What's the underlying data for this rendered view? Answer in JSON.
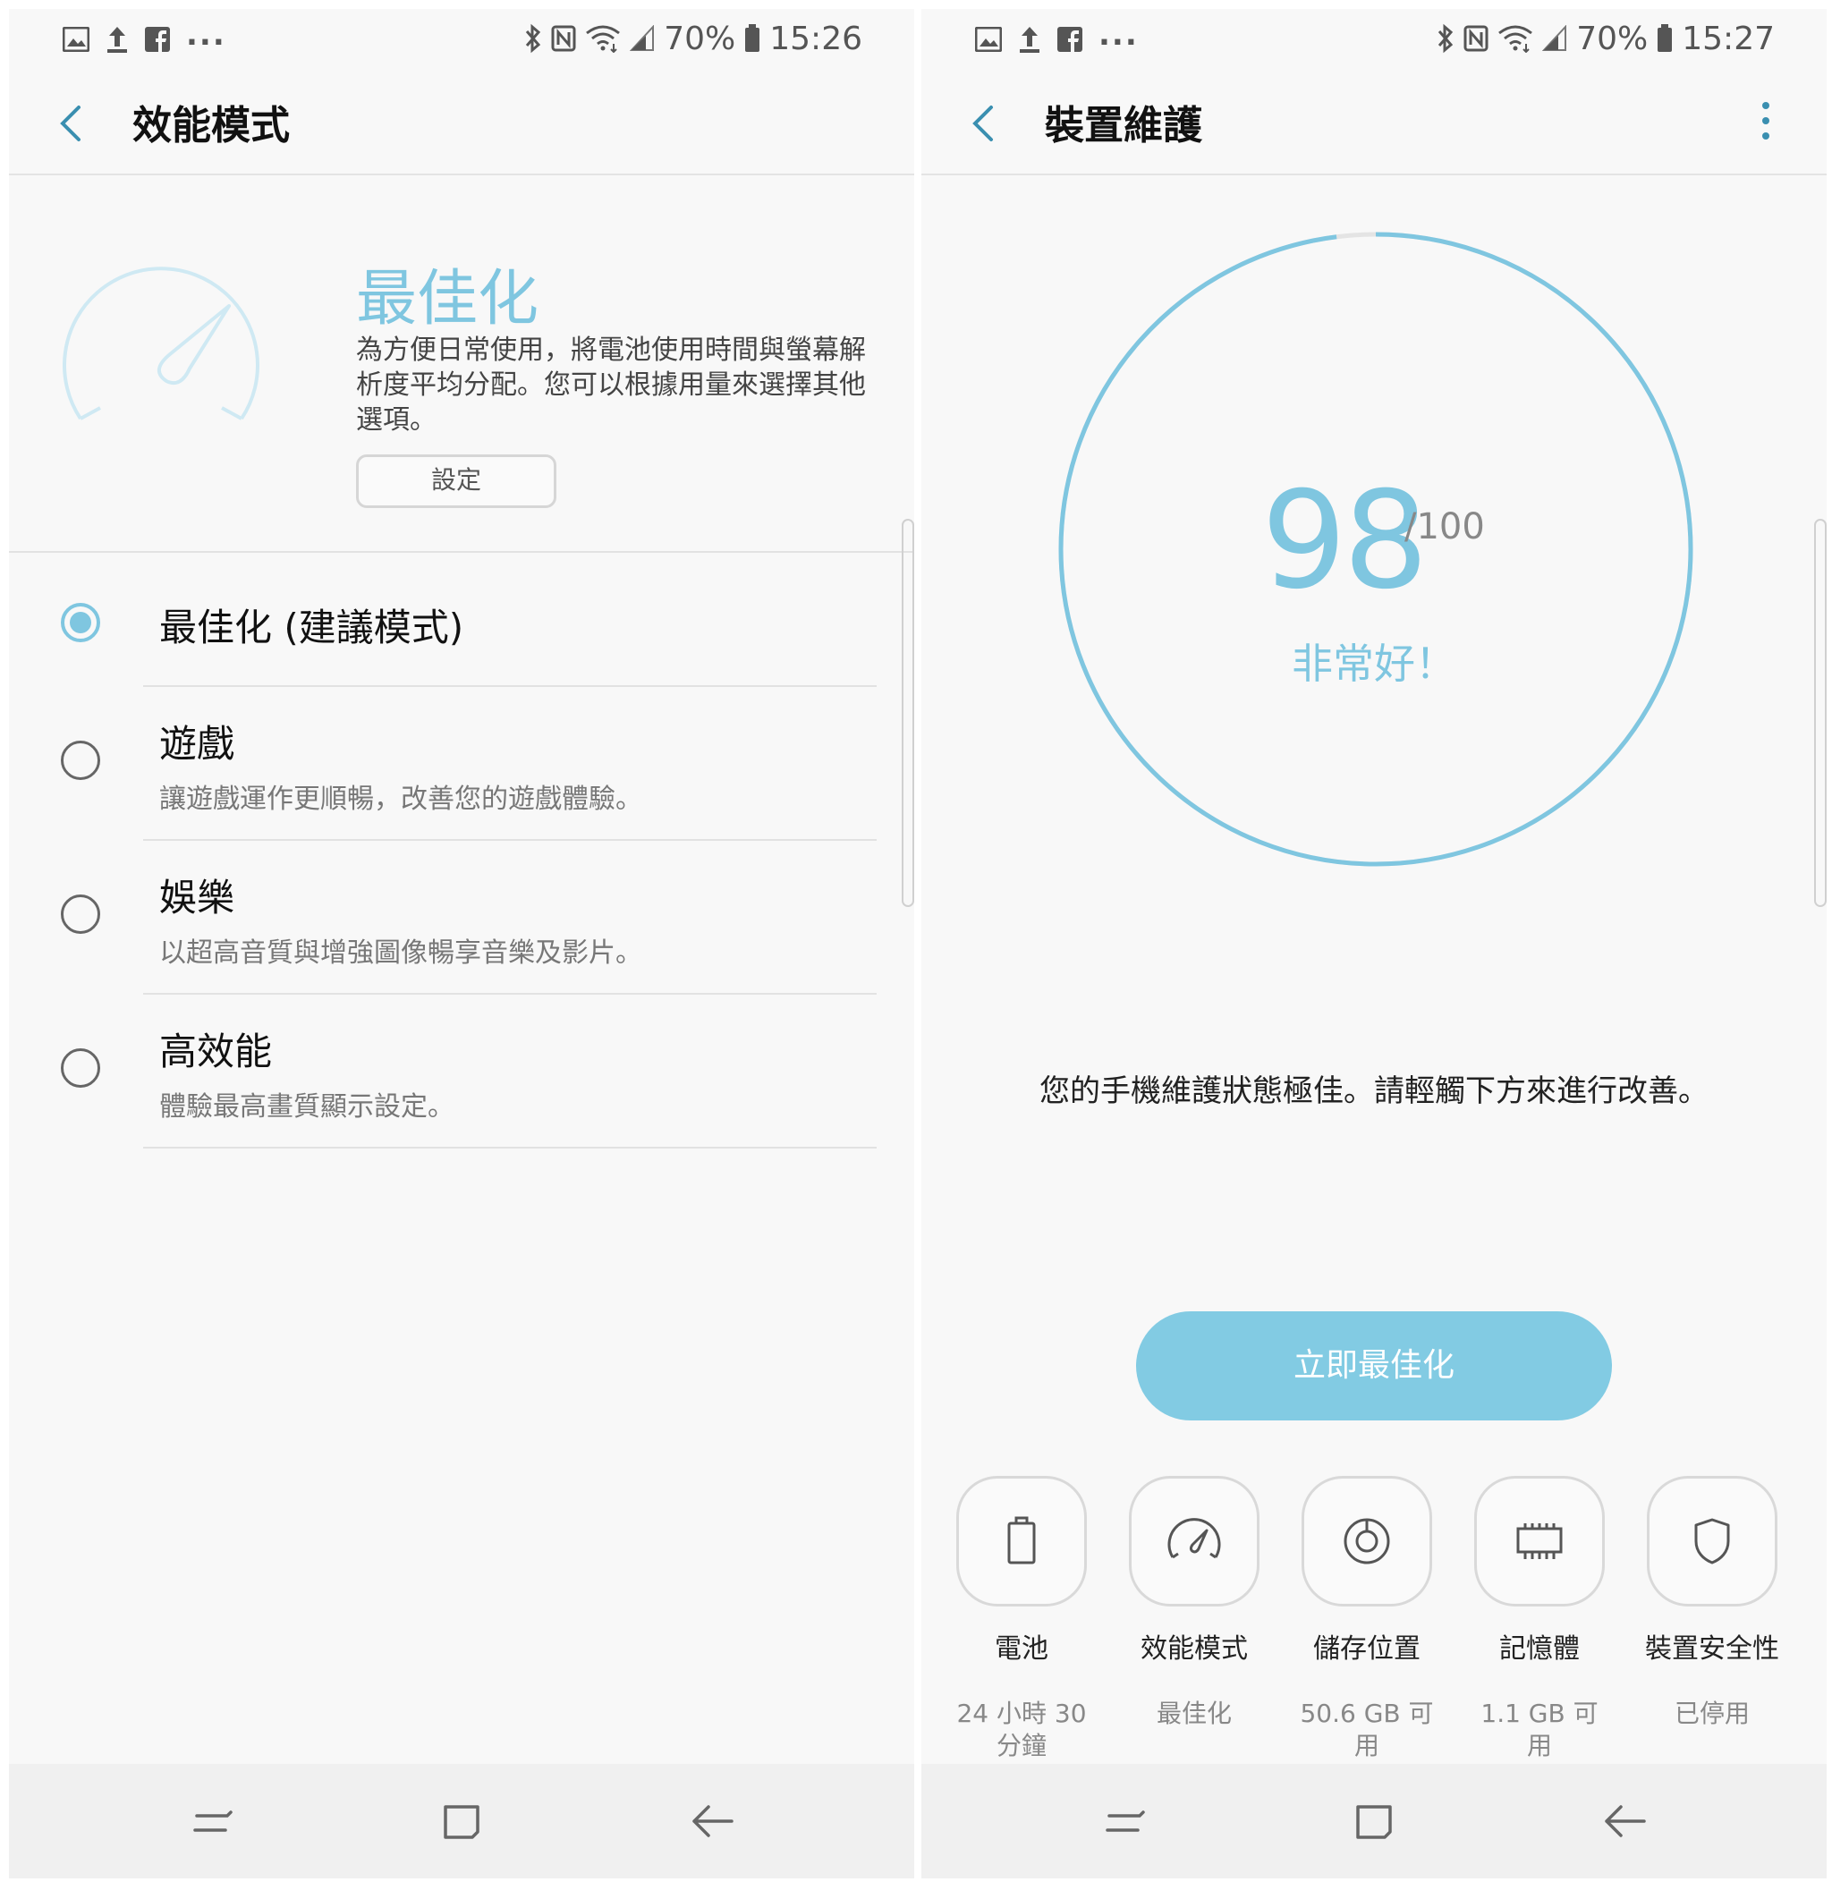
{
  "left": {
    "status": {
      "battery_pct": "70%",
      "time": "15:26",
      "dots": "..."
    },
    "appbar": {
      "title": "效能模式"
    },
    "hero": {
      "mode_title": "最佳化",
      "description": "為方便日常使用，將電池使用時間與螢幕解析度平均分配。您可以根據用量來選擇其他選項。",
      "settings_button": "設定"
    },
    "options": [
      {
        "title": "最佳化 (建議模式)",
        "desc": "",
        "selected": true
      },
      {
        "title": "遊戲",
        "desc": "讓遊戲運作更順暢，改善您的遊戲體驗。",
        "selected": false
      },
      {
        "title": "娛樂",
        "desc": "以超高音質與增強圖像暢享音樂及影片。",
        "selected": false
      },
      {
        "title": "高效能",
        "desc": "體驗最高畫質顯示設定。",
        "selected": false
      }
    ]
  },
  "right": {
    "status": {
      "battery_pct": "70%",
      "time": "15:27",
      "dots": "..."
    },
    "appbar": {
      "title": "裝置維護"
    },
    "score": {
      "value": "98",
      "max": "/100",
      "value_num": 98,
      "label": "非常好！"
    },
    "summary": "您的手機維護狀態極佳。請輕觸下方來進行改善。",
    "optimize_button": "立即最佳化",
    "tiles": [
      {
        "name": "電池",
        "value": "24 小時 30 分鐘",
        "icon": "battery-icon"
      },
      {
        "name": "效能模式",
        "value": "最佳化",
        "icon": "speedometer-icon"
      },
      {
        "name": "儲存位置",
        "value": "50.6 GB 可用",
        "icon": "storage-disc-icon"
      },
      {
        "name": "記憶體",
        "value": "1.1 GB 可用",
        "icon": "memory-chip-icon"
      },
      {
        "name": "裝置安全性",
        "value": "已停用",
        "icon": "shield-icon"
      }
    ]
  },
  "colors": {
    "accent": "#7fc6e0",
    "button": "#82cbe3",
    "text": "#111111",
    "muted": "#777777"
  }
}
